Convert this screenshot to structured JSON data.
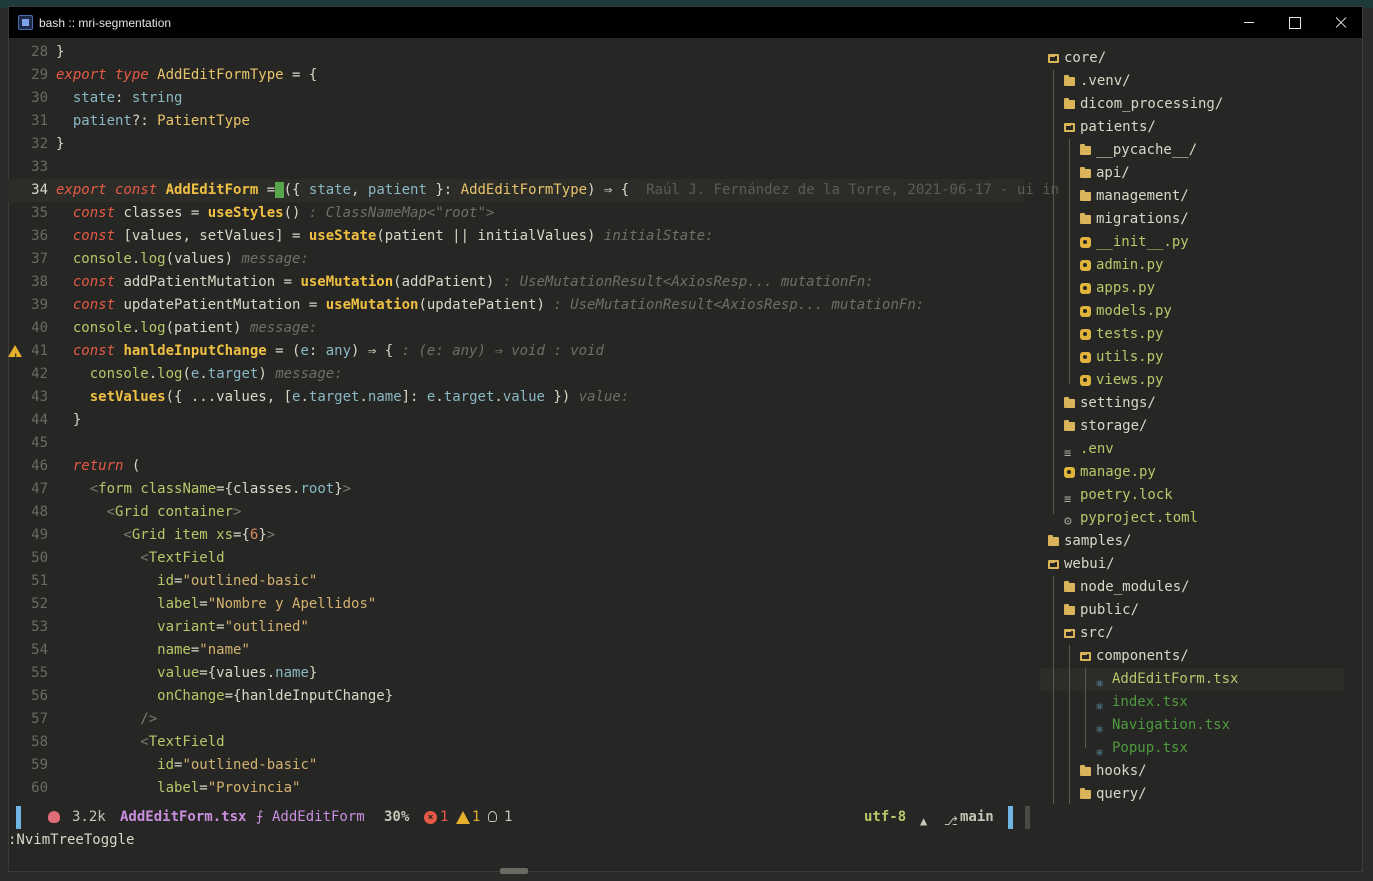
{
  "window": {
    "title": "bash :: mri-segmentation"
  },
  "editor": {
    "lines": [
      {
        "n": "28",
        "tokens": [
          [
            "op",
            "}"
          ]
        ]
      },
      {
        "n": "29",
        "tokens": [
          [
            "kw",
            "export type "
          ],
          [
            "ty",
            "AddEditFormType"
          ],
          [
            "op",
            " = {"
          ]
        ]
      },
      {
        "n": "30",
        "tokens": [
          [
            "pr",
            "  state"
          ],
          [
            "op",
            ": "
          ],
          [
            "pr",
            "string"
          ]
        ]
      },
      {
        "n": "31",
        "tokens": [
          [
            "pr",
            "  patient"
          ],
          [
            "op",
            "?: "
          ],
          [
            "ty",
            "PatientType"
          ]
        ]
      },
      {
        "n": "32",
        "tokens": [
          [
            "op",
            "}"
          ]
        ]
      },
      {
        "n": "33",
        "tokens": []
      },
      {
        "n": "34",
        "tokens": [
          [
            "kw",
            "export const "
          ],
          [
            "fn",
            "AddEditForm"
          ],
          [
            "op",
            " ="
          ],
          [
            "cursor",
            " "
          ],
          [
            "op",
            "({ "
          ],
          [
            "pr",
            "state"
          ],
          [
            "op",
            ", "
          ],
          [
            "pr",
            "patient"
          ],
          [
            "op",
            " }: "
          ],
          [
            "ty",
            "AddEditFormType"
          ],
          [
            "op",
            ") ⇒ {  "
          ],
          [
            "blame",
            "Raúl J. Fernández de la Torre, 2021-06-17 - ui in"
          ]
        ]
      },
      {
        "n": "35",
        "tokens": [
          [
            "kw",
            "  const "
          ],
          [
            "op",
            "classes = "
          ],
          [
            "fn",
            "useStyles"
          ],
          [
            "op",
            "() "
          ],
          [
            "hint",
            ": ClassNameMap<\"root\">"
          ]
        ]
      },
      {
        "n": "36",
        "tokens": [
          [
            "kw",
            "  const "
          ],
          [
            "op",
            "[values, setValues] = "
          ],
          [
            "fn",
            "useState"
          ],
          [
            "op",
            "(patient || initialValues) "
          ],
          [
            "hint",
            "initialState:"
          ]
        ]
      },
      {
        "n": "37",
        "tokens": [
          [
            "tg",
            "  console"
          ],
          [
            "op",
            "."
          ],
          [
            "tg",
            "log"
          ],
          [
            "op",
            "(values) "
          ],
          [
            "hint",
            "message:"
          ]
        ]
      },
      {
        "n": "38",
        "tokens": [
          [
            "kw",
            "  const "
          ],
          [
            "op",
            "addPatientMutation = "
          ],
          [
            "fn",
            "useMutation"
          ],
          [
            "op",
            "(addPatient) "
          ],
          [
            "hint",
            ": UseMutationResult<AxiosResp... mutationFn:"
          ]
        ]
      },
      {
        "n": "39",
        "tokens": [
          [
            "kw",
            "  const "
          ],
          [
            "op",
            "updatePatientMutation = "
          ],
          [
            "fn",
            "useMutation"
          ],
          [
            "op",
            "(updatePatient) "
          ],
          [
            "hint",
            ": UseMutationResult<AxiosResp... mutationFn:"
          ]
        ]
      },
      {
        "n": "40",
        "tokens": [
          [
            "tg",
            "  console"
          ],
          [
            "op",
            "."
          ],
          [
            "tg",
            "log"
          ],
          [
            "op",
            "(patient) "
          ],
          [
            "hint",
            "message:"
          ]
        ]
      },
      {
        "n": "41",
        "warn": true,
        "tokens": [
          [
            "kw",
            "  const "
          ],
          [
            "fn",
            "hanldeInputChange"
          ],
          [
            "op",
            " = ("
          ],
          [
            "pr",
            "e"
          ],
          [
            "op",
            ": "
          ],
          [
            "pr",
            "any"
          ],
          [
            "op",
            ") ⇒ { "
          ],
          [
            "hint",
            ": (e: any) ⇒ void : void"
          ]
        ]
      },
      {
        "n": "42",
        "tokens": [
          [
            "tg",
            "    console"
          ],
          [
            "op",
            "."
          ],
          [
            "tg",
            "log"
          ],
          [
            "op",
            "("
          ],
          [
            "pr",
            "e"
          ],
          [
            "op",
            "."
          ],
          [
            "pr",
            "target"
          ],
          [
            "op",
            ") "
          ],
          [
            "hint",
            "message:"
          ]
        ]
      },
      {
        "n": "43",
        "tokens": [
          [
            "fn",
            "    setValues"
          ],
          [
            "op",
            "({ ...values, ["
          ],
          [
            "pr",
            "e"
          ],
          [
            "op",
            "."
          ],
          [
            "pr",
            "target"
          ],
          [
            "op",
            "."
          ],
          [
            "pr",
            "name"
          ],
          [
            "op",
            "]: "
          ],
          [
            "pr",
            "e"
          ],
          [
            "op",
            "."
          ],
          [
            "pr",
            "target"
          ],
          [
            "op",
            "."
          ],
          [
            "pr",
            "value"
          ],
          [
            "op",
            " }) "
          ],
          [
            "hint",
            "value:"
          ]
        ]
      },
      {
        "n": "44",
        "tokens": [
          [
            "op",
            "  }"
          ]
        ]
      },
      {
        "n": "45",
        "tokens": []
      },
      {
        "n": "46",
        "tokens": [
          [
            "kw",
            "  return "
          ],
          [
            "op",
            "("
          ]
        ]
      },
      {
        "n": "47",
        "tokens": [
          [
            "ang",
            "    <"
          ],
          [
            "tg",
            "form "
          ],
          [
            "tg",
            "className"
          ],
          [
            "op",
            "={classes."
          ],
          [
            "pr",
            "root"
          ],
          [
            "op",
            "}"
          ],
          [
            "ang",
            ">"
          ]
        ]
      },
      {
        "n": "48",
        "tokens": [
          [
            "ang",
            "      <"
          ],
          [
            "tg",
            "Grid container"
          ],
          [
            "ang",
            ">"
          ]
        ]
      },
      {
        "n": "49",
        "tokens": [
          [
            "ang",
            "        <"
          ],
          [
            "tg",
            "Grid item xs"
          ],
          [
            "op",
            "={"
          ],
          [
            "num",
            "6"
          ],
          [
            "op",
            "}"
          ],
          [
            "ang",
            ">"
          ]
        ]
      },
      {
        "n": "50",
        "tokens": [
          [
            "ang",
            "          <"
          ],
          [
            "tg",
            "TextField"
          ]
        ]
      },
      {
        "n": "51",
        "tokens": [
          [
            "tg",
            "            id"
          ],
          [
            "op",
            "="
          ],
          [
            "st",
            "\"outlined-basic\""
          ]
        ]
      },
      {
        "n": "52",
        "tokens": [
          [
            "tg",
            "            label"
          ],
          [
            "op",
            "="
          ],
          [
            "st",
            "\"Nombre y Apellidos\""
          ]
        ]
      },
      {
        "n": "53",
        "tokens": [
          [
            "tg",
            "            variant"
          ],
          [
            "op",
            "="
          ],
          [
            "st",
            "\"outlined\""
          ]
        ]
      },
      {
        "n": "54",
        "tokens": [
          [
            "tg",
            "            name"
          ],
          [
            "op",
            "="
          ],
          [
            "st",
            "\"name\""
          ]
        ]
      },
      {
        "n": "55",
        "tokens": [
          [
            "tg",
            "            value"
          ],
          [
            "op",
            "={values."
          ],
          [
            "pr",
            "name"
          ],
          [
            "op",
            "}"
          ]
        ]
      },
      {
        "n": "56",
        "tokens": [
          [
            "tg",
            "            onChange"
          ],
          [
            "op",
            "={hanldeInputChange}"
          ]
        ]
      },
      {
        "n": "57",
        "tokens": [
          [
            "ang",
            "          />"
          ]
        ]
      },
      {
        "n": "58",
        "tokens": [
          [
            "ang",
            "          <"
          ],
          [
            "tg",
            "TextField"
          ]
        ]
      },
      {
        "n": "59",
        "tokens": [
          [
            "tg",
            "            id"
          ],
          [
            "op",
            "="
          ],
          [
            "st",
            "\"outlined-basic\""
          ]
        ]
      },
      {
        "n": "60",
        "tokens": [
          [
            "tg",
            "            label"
          ],
          [
            "op",
            "="
          ],
          [
            "st",
            "\"Provincia\""
          ]
        ]
      }
    ],
    "current_line": "34"
  },
  "tree": {
    "nodes": [
      {
        "label": "core/",
        "depth": 0,
        "kind": "folder-open"
      },
      {
        "label": ".venv/",
        "depth": 1,
        "kind": "folder"
      },
      {
        "label": "dicom_processing/",
        "depth": 1,
        "kind": "folder"
      },
      {
        "label": "patients/",
        "depth": 1,
        "kind": "folder-open"
      },
      {
        "label": "__pycache__/",
        "depth": 2,
        "kind": "folder"
      },
      {
        "label": "api/",
        "depth": 2,
        "kind": "folder"
      },
      {
        "label": "management/",
        "depth": 2,
        "kind": "folder"
      },
      {
        "label": "migrations/",
        "depth": 2,
        "kind": "folder"
      },
      {
        "label": "__init__.py",
        "depth": 2,
        "kind": "py"
      },
      {
        "label": "admin.py",
        "depth": 2,
        "kind": "py"
      },
      {
        "label": "apps.py",
        "depth": 2,
        "kind": "py"
      },
      {
        "label": "models.py",
        "depth": 2,
        "kind": "py"
      },
      {
        "label": "tests.py",
        "depth": 2,
        "kind": "py"
      },
      {
        "label": "utils.py",
        "depth": 2,
        "kind": "py"
      },
      {
        "label": "views.py",
        "depth": 2,
        "kind": "py"
      },
      {
        "label": "settings/",
        "depth": 1,
        "kind": "folder"
      },
      {
        "label": "storage/",
        "depth": 1,
        "kind": "folder"
      },
      {
        "label": ".env",
        "depth": 1,
        "kind": "file"
      },
      {
        "label": "manage.py",
        "depth": 1,
        "kind": "py"
      },
      {
        "label": "poetry.lock",
        "depth": 1,
        "kind": "file"
      },
      {
        "label": "pyproject.toml",
        "depth": 1,
        "kind": "gear"
      },
      {
        "label": "samples/",
        "depth": 0,
        "kind": "folder"
      },
      {
        "label": "webui/",
        "depth": 0,
        "kind": "folder-open"
      },
      {
        "label": "node_modules/",
        "depth": 1,
        "kind": "folder"
      },
      {
        "label": "public/",
        "depth": 1,
        "kind": "folder"
      },
      {
        "label": "src/",
        "depth": 1,
        "kind": "folder-open"
      },
      {
        "label": "components/",
        "depth": 2,
        "kind": "folder-open"
      },
      {
        "label": "AddEditForm.tsx",
        "depth": 3,
        "kind": "tsx",
        "selected": true
      },
      {
        "label": "index.tsx",
        "depth": 3,
        "kind": "tsx"
      },
      {
        "label": "Navigation.tsx",
        "depth": 3,
        "kind": "tsx"
      },
      {
        "label": "Popup.tsx",
        "depth": 3,
        "kind": "tsx"
      },
      {
        "label": "hooks/",
        "depth": 2,
        "kind": "folder"
      },
      {
        "label": "query/",
        "depth": 2,
        "kind": "folder"
      }
    ]
  },
  "status": {
    "size": "3.2k",
    "filename": "AddEditForm.tsx",
    "function_symbol": "⨍",
    "function": "AddEditForm",
    "percent": "30%",
    "errors": "1",
    "warnings": "1",
    "hints": "1",
    "encoding": "utf-8",
    "branch": "main"
  },
  "cmdline": ":NvimTreeToggle"
}
